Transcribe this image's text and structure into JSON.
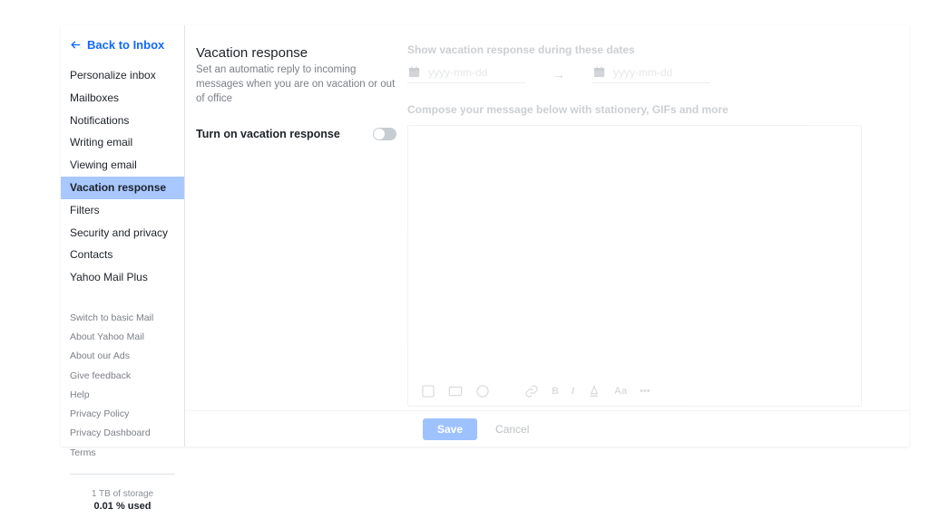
{
  "back_link": "Back to Inbox",
  "sidebar": {
    "nav": [
      {
        "label": "Personalize inbox",
        "active": false
      },
      {
        "label": "Mailboxes",
        "active": false
      },
      {
        "label": "Notifications",
        "active": false
      },
      {
        "label": "Writing email",
        "active": false
      },
      {
        "label": "Viewing email",
        "active": false
      },
      {
        "label": "Vacation response",
        "active": true
      },
      {
        "label": "Filters",
        "active": false
      },
      {
        "label": "Security and privacy",
        "active": false
      },
      {
        "label": "Contacts",
        "active": false
      },
      {
        "label": "Yahoo Mail Plus",
        "active": false
      }
    ],
    "secondary": [
      "Switch to basic Mail",
      "About Yahoo Mail",
      "About our Ads",
      "Give feedback",
      "Help",
      "Privacy Policy",
      "Privacy Dashboard",
      "Terms"
    ],
    "storage_line1": "1 TB of storage",
    "storage_line2": "0.01 % used"
  },
  "main": {
    "title": "Vacation response",
    "subtitle": "Set an automatic reply to incoming messages when you are on vacation or out of office",
    "toggle_label": "Turn on vacation response",
    "dates_label": "Show vacation response during these dates",
    "date_placeholder": "yyyy-mm-dd",
    "compose_label": "Compose your message below with stationery, GIFs and more",
    "toolbar": {
      "link": "ⓘⓞ",
      "bold": "B",
      "italic": "I"
    }
  },
  "footer": {
    "save": "Save",
    "cancel": "Cancel"
  }
}
